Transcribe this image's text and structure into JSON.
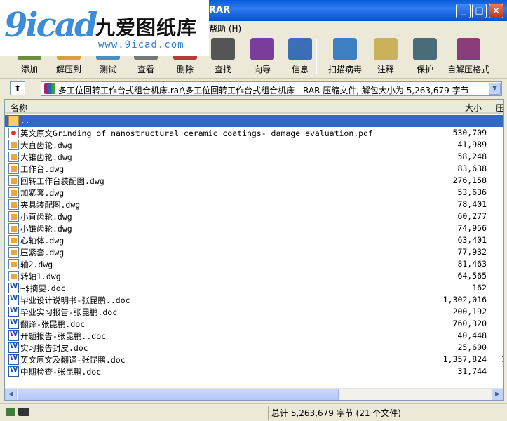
{
  "window": {
    "title": "RAR",
    "min_label": "_",
    "max_label": "□",
    "close_label": "×"
  },
  "logo": {
    "mark": "9icad",
    "brand": "九爱图纸库",
    "url": "www.9icad.com"
  },
  "menu": {
    "items": [
      {
        "label": "帮助 (H)"
      }
    ]
  },
  "toolbar": {
    "items": [
      {
        "label": "添加",
        "icon": "add-icon",
        "color": "#6B8E3D"
      },
      {
        "label": "解压到",
        "icon": "extract-icon",
        "color": "#D4A33A"
      },
      {
        "label": "测试",
        "icon": "test-icon",
        "color": "#4A90C8"
      },
      {
        "label": "查看",
        "icon": "view-icon",
        "color": "#777777"
      },
      {
        "label": "删除",
        "icon": "delete-icon",
        "color": "#B83A3A"
      },
      {
        "label": "查找",
        "icon": "find-icon",
        "color": "#555555"
      },
      {
        "label": "向导",
        "icon": "wizard-icon",
        "color": "#7A3D9B"
      },
      {
        "label": "信息",
        "icon": "info-icon",
        "color": "#3A6FB8"
      },
      {
        "label": "扫描病毒",
        "icon": "virus-scan-icon",
        "color": "#3E7FC1"
      },
      {
        "label": "注释",
        "icon": "comment-icon",
        "color": "#C9B25A"
      },
      {
        "label": "保护",
        "icon": "protect-icon",
        "color": "#4A6B7A"
      },
      {
        "label": "自解压格式",
        "icon": "sfx-icon",
        "color": "#8A3D7A"
      }
    ]
  },
  "address": {
    "up_label": "⬆",
    "path": "多工位回转工作台式组合机床.rar\\多工位回转工作台式组合机床 - RAR 压缩文件, 解包大小为 5,263,679 字节",
    "dropdown_label": "▼"
  },
  "columns": {
    "name": "名称",
    "size": "大小",
    "packed": "压"
  },
  "files": [
    {
      "name": "..",
      "size": "",
      "type": "folder",
      "selected": true
    },
    {
      "name": "英文原文Grinding of nanostructural ceramic coatings- damage evaluation.pdf",
      "size": "530,709",
      "type": "pdf"
    },
    {
      "name": "大直齿轮.dwg",
      "size": "41,989",
      "type": "dwg"
    },
    {
      "name": "大锥齿轮.dwg",
      "size": "58,248",
      "type": "dwg"
    },
    {
      "name": "工作台.dwg",
      "size": "83,638",
      "type": "dwg"
    },
    {
      "name": "回转工作台装配图.dwg",
      "size": "276,158",
      "type": "dwg"
    },
    {
      "name": "加紧套.dwg",
      "size": "53,636",
      "type": "dwg"
    },
    {
      "name": "夹具装配图.dwg",
      "size": "78,401",
      "type": "dwg"
    },
    {
      "name": "小直齿轮.dwg",
      "size": "60,277",
      "type": "dwg"
    },
    {
      "name": "小锥齿轮.dwg",
      "size": "74,956",
      "type": "dwg"
    },
    {
      "name": "心轴体.dwg",
      "size": "63,401",
      "type": "dwg"
    },
    {
      "name": "压紧套.dwg",
      "size": "77,932",
      "type": "dwg"
    },
    {
      "name": "轴2.dwg",
      "size": "81,463",
      "type": "dwg"
    },
    {
      "name": "转轴1.dwg",
      "size": "64,565",
      "type": "dwg"
    },
    {
      "name": "~$摘要.doc",
      "size": "162",
      "type": "doc"
    },
    {
      "name": "毕业设计说明书-张昆鹏..doc",
      "size": "1,302,016",
      "type": "doc"
    },
    {
      "name": "毕业实习报告-张昆鹏.doc",
      "size": "200,192",
      "type": "doc"
    },
    {
      "name": "翻译-张昆鹏.doc",
      "size": "760,320",
      "type": "doc"
    },
    {
      "name": "开题报告-张昆鹏..doc",
      "size": "40,448",
      "type": "doc"
    },
    {
      "name": "实习报告封皮.doc",
      "size": "25,600",
      "type": "doc"
    },
    {
      "name": "英文原文及翻译-张昆鹏.doc",
      "size": "1,357,824",
      "type": "doc",
      "clip": "1"
    },
    {
      "name": "中期检查-张昆鹏.doc",
      "size": "31,744",
      "type": "doc"
    }
  ],
  "status": {
    "total": "总计 5,263,679 字节 (21 个文件)"
  }
}
